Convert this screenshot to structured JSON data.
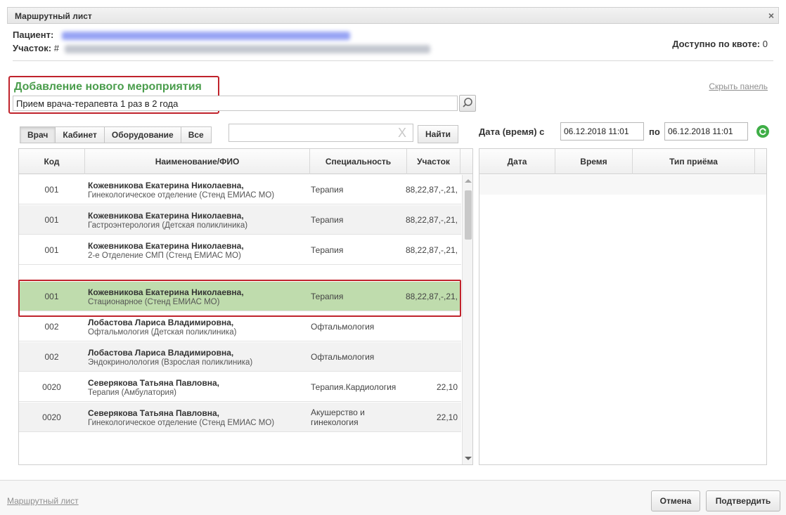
{
  "window": {
    "title": "Маршрутный лист",
    "close_glyph": "×"
  },
  "patient": {
    "label": "Пациент:",
    "uchastok_label": "Участок:",
    "uchastok_prefix": "#"
  },
  "quota": {
    "label": "Доступно по квоте:",
    "value": "0"
  },
  "add_event": {
    "title": "Добавление нового мероприятия",
    "hide_panel": "Скрыть панель",
    "input_value": "Прием врача-терапевта 1 раз в 2 года"
  },
  "tabs": [
    "Врач",
    "Кабинет",
    "Оборудование",
    "Все"
  ],
  "filter": {
    "clear_glyph": "X",
    "find_label": "Найти"
  },
  "date_range": {
    "from_label": "Дата (время) с",
    "from_value": "06.12.2018 11:01",
    "to_label": "по",
    "to_value": "06.12.2018 11:01"
  },
  "grid": {
    "columns": [
      "Код",
      "Наименование/ФИО",
      "Специальность",
      "Участок"
    ],
    "rows": [
      {
        "code": "001",
        "name": "Кожевникова Екатерина Николаевна,",
        "dept": "Гинекологическое отделение (Стенд ЕМИАС МО)",
        "spec": "Терапия",
        "uch": "88,22,87,-,21,"
      },
      {
        "code": "001",
        "name": "Кожевникова Екатерина Николаевна,",
        "dept": "Гастроэнтерология (Детская поликлиника)",
        "spec": "Терапия",
        "uch": "88,22,87,-,21,"
      },
      {
        "code": "001",
        "name": "Кожевникова Екатерина Николаевна,",
        "dept": "2-е Отделение СМП (Стенд ЕМИАС МО)",
        "spec": "Терапия",
        "uch": "88,22,87,-,21,"
      },
      {
        "code": "001",
        "name": "Кожевникова Екатерина Николаевна,",
        "dept": "Стационарное (Стенд ЕМИАС МО)",
        "spec": "Терапия",
        "uch": "88,22,87,-,21,"
      },
      {
        "code": "002",
        "name": "Лобастова Лариса Владимировна,",
        "dept": "Офтальмология (Детская поликлиника)",
        "spec": "Офтальмология",
        "uch": ""
      },
      {
        "code": "002",
        "name": "Лобастова Лариса Владимировна,",
        "dept": "Эндокринолология (Взрослая поликлиника)",
        "spec": "Офтальмология",
        "uch": ""
      },
      {
        "code": "0020",
        "name": "Северякова Татьяна Павловна,",
        "dept": "Терапия (Амбулатория)",
        "spec": "Терапия.Кардиология",
        "uch": "22,10"
      },
      {
        "code": "0020",
        "name": "Северякова Татьяна Павловна,",
        "dept": "Гинекологическое отделение (Стенд ЕМИАС МО)",
        "spec": "Акушерство и гинекология",
        "uch": "22,10"
      }
    ]
  },
  "schedule": {
    "columns": [
      "Дата",
      "Время",
      "Тип приёма"
    ]
  },
  "footer": {
    "link": "Маршрутный лист",
    "cancel": "Отмена",
    "confirm": "Подтвердить"
  },
  "colors": {
    "accent_green": "#4a9d4c",
    "highlight_red": "#c0232c",
    "selected_row": "#bfdcad",
    "refresh_green": "#3fae47"
  },
  "icons": {
    "search": "search-icon",
    "refresh": "refresh-icon",
    "close": "close-icon"
  }
}
